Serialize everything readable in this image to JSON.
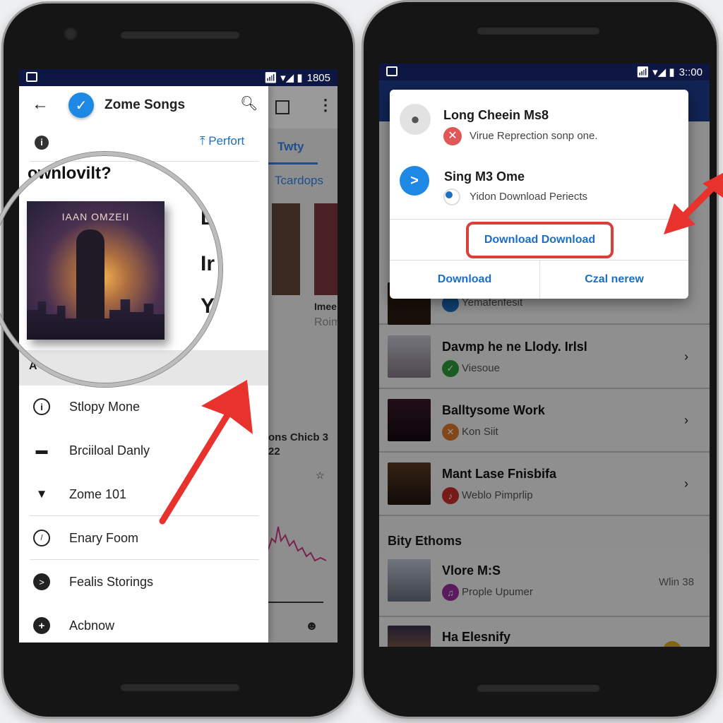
{
  "left_phone": {
    "status_bar": {
      "time": "1805"
    },
    "drawer": {
      "title": "Zome Songs",
      "action_label": "Perfort",
      "heading": "ownlovilt?",
      "album_art_text": "IAAN OMZEII",
      "partial_letters": [
        "L",
        "Ir",
        "Y"
      ],
      "partial_row_label": "A",
      "menu_items": [
        {
          "label": "Stlopy Mone",
          "icon": "info-icon"
        },
        {
          "label": "Brciiloal Danly",
          "icon": "person-icon"
        },
        {
          "label": "Zome 101",
          "icon": "location-pin-icon"
        },
        {
          "label": "Enary Foom",
          "icon": "gauge-icon"
        },
        {
          "label": "Fealis Storings",
          "icon": "arrow-circle-icon"
        },
        {
          "label": "Acbnow",
          "icon": "plus-circle-icon"
        }
      ]
    },
    "background_app": {
      "tabs": [
        "Twty",
        "Tcardops"
      ],
      "card_title": "Imee",
      "card_sub": "Roim",
      "chart_caption": [
        "ons Chicb 3",
        "22"
      ]
    }
  },
  "right_phone": {
    "status_bar": {
      "time": "3::00"
    },
    "dialog": {
      "items": [
        {
          "title": "Long Cheein Ms8",
          "subtitle": "Virue Reprection sonp one.",
          "icon": "person-icon",
          "status_icon": "error-x-icon"
        },
        {
          "title": "Sing M3 Ome",
          "subtitle": "Yidon Download Periects",
          "icon": "chevron-right-icon",
          "status_icon": "toggle-icon"
        }
      ],
      "highlight_button": "Download Download",
      "left_button": "Download",
      "right_button": "Czal nerew"
    },
    "list": {
      "hidden_row_sub": "Yemafenfesit",
      "rows": [
        {
          "title": "Davmp he ne Llody. Irlsl",
          "subtitle": "Viesoue",
          "color": "#2e9e3e"
        },
        {
          "title": "Balltysome Work",
          "subtitle": "Kon Siit",
          "color": "#e07a2a"
        },
        {
          "title": "Mant Lase Fnisbifa",
          "subtitle": "Weblo Pimprlip",
          "color": "#cc2d2d"
        }
      ],
      "section_title": "Bity Ethoms",
      "section_rows": [
        {
          "title": "Vlore M:S",
          "subtitle": "Prople Upumer",
          "meta": "Wlin 38",
          "color": "#9c2fa0"
        },
        {
          "title": "Ha Elesnify",
          "subtitle": "",
          "meta": "",
          "color": "#e0b020"
        }
      ]
    }
  },
  "colors": {
    "accent_blue": "#1e88e5",
    "status_navy": "#0e1744",
    "arrow_red": "#e8322e"
  }
}
